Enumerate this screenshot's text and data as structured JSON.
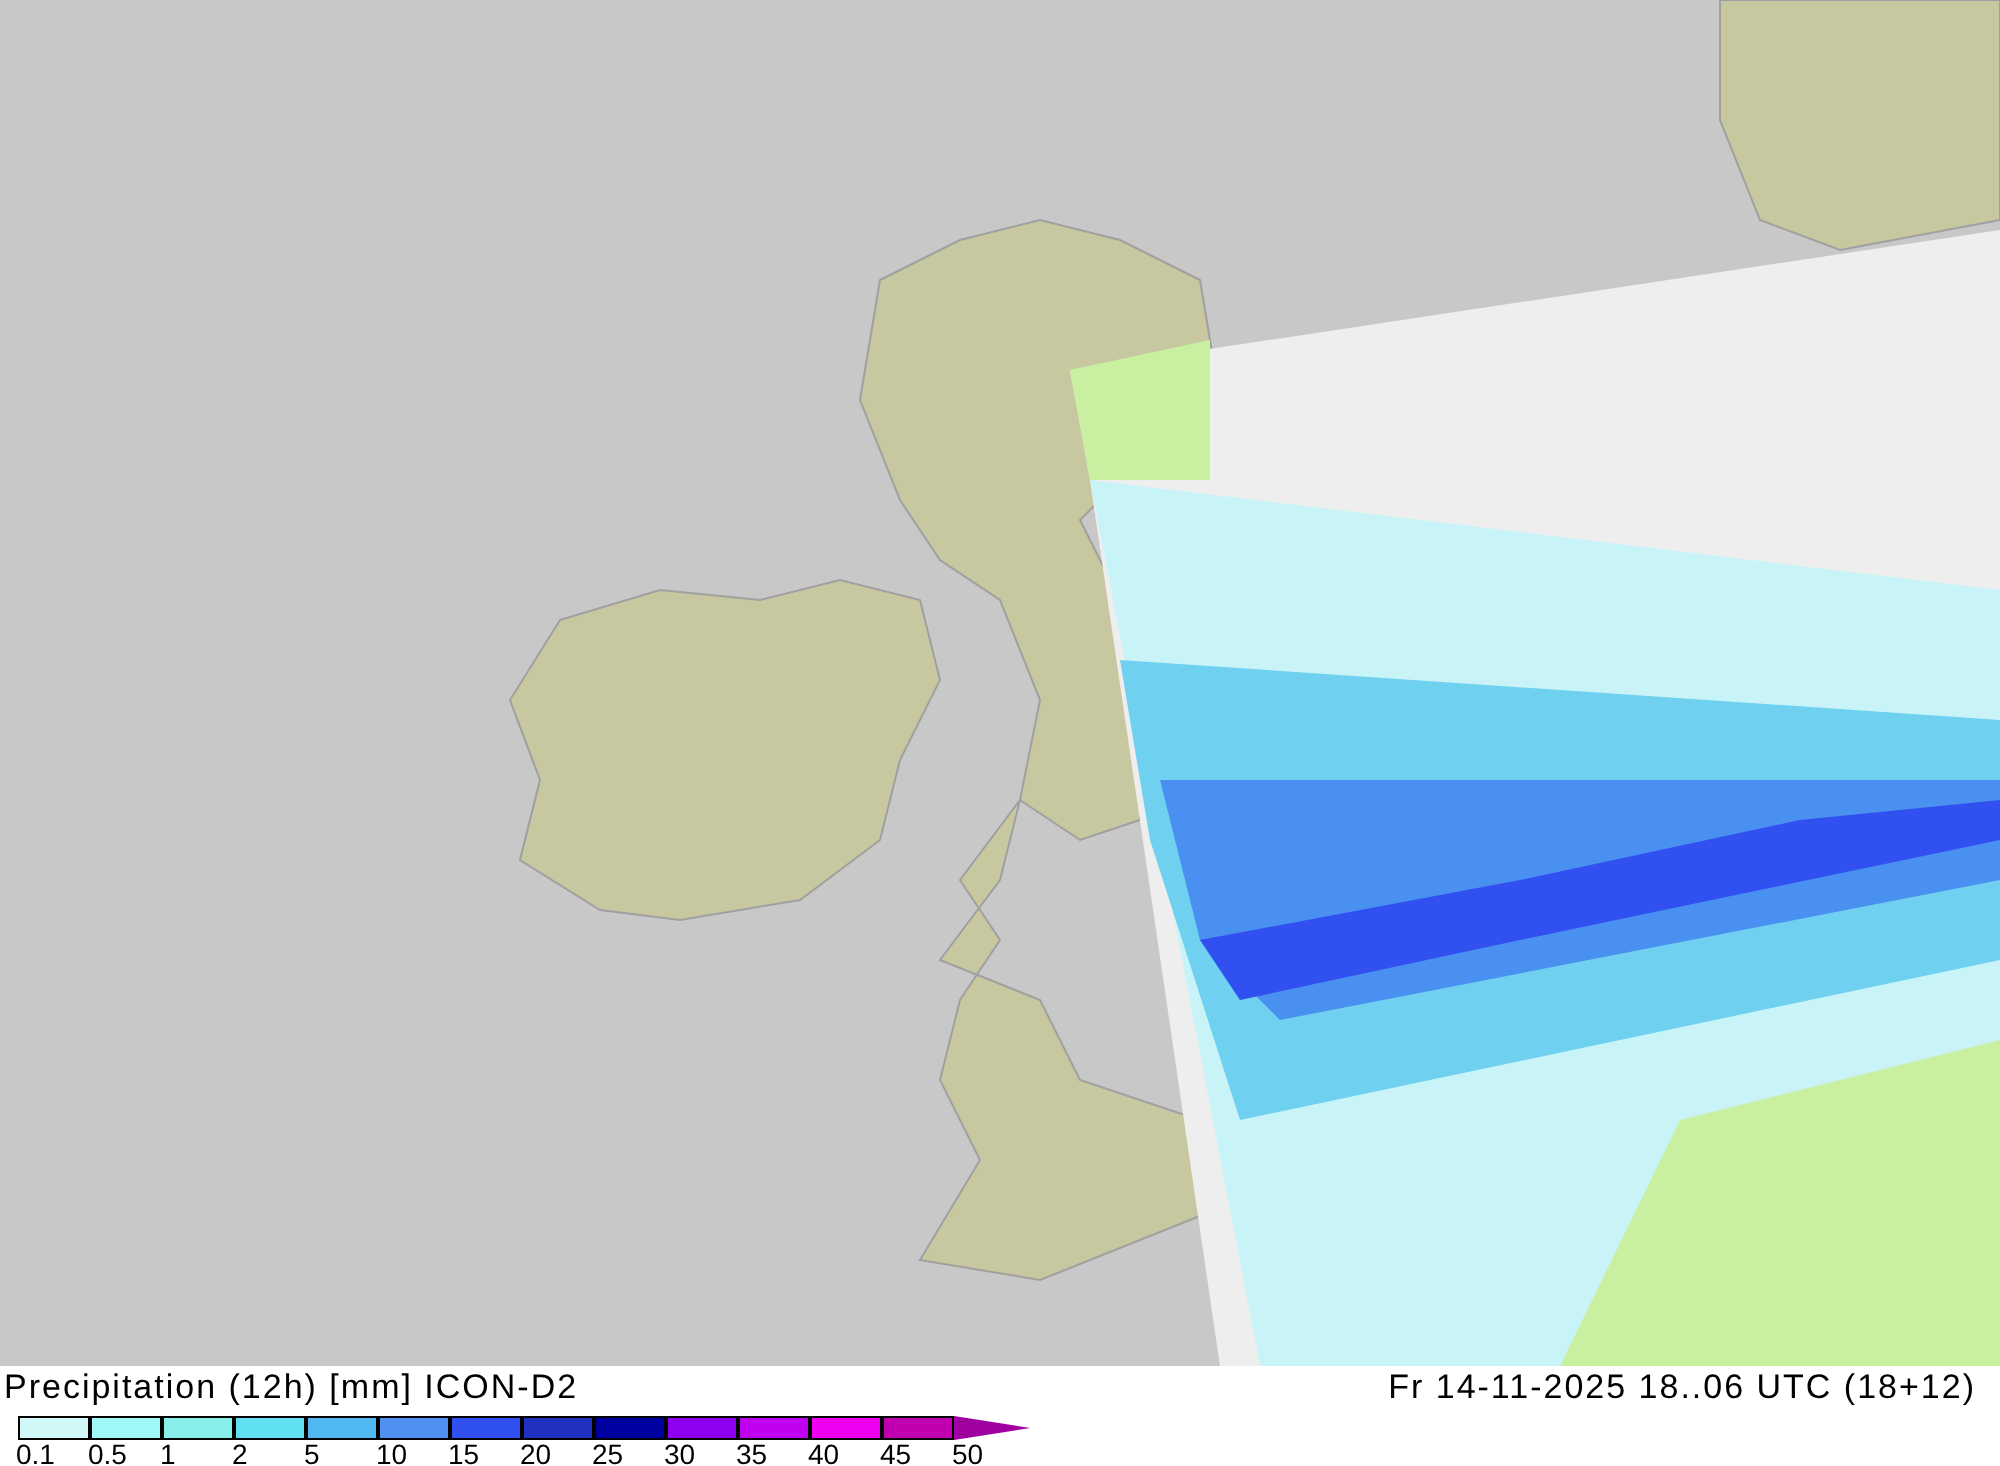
{
  "title": "Precipitation (12h) [mm] ICON-D2",
  "valid_time": "Fr 14-11-2025 18..06 UTC (18+12)",
  "legend": {
    "classes": [
      {
        "color": "#d0f8f8"
      },
      {
        "color": "#a0f8f8"
      },
      {
        "color": "#88f0e8"
      },
      {
        "color": "#60e0f0"
      },
      {
        "color": "#50b8f0"
      },
      {
        "color": "#5090f0"
      },
      {
        "color": "#3050f0"
      },
      {
        "color": "#2030c0"
      },
      {
        "color": "#0000a0"
      },
      {
        "color": "#9000f0"
      },
      {
        "color": "#c000f0"
      },
      {
        "color": "#f000f0"
      },
      {
        "color": "#c000b0"
      }
    ],
    "ticks": [
      "0.1",
      "0.5",
      "1",
      "2",
      "5",
      "10",
      "15",
      "20",
      "25",
      "30",
      "35",
      "40",
      "45",
      "50"
    ],
    "arrow": {
      "color": "#a000a0"
    }
  }
}
